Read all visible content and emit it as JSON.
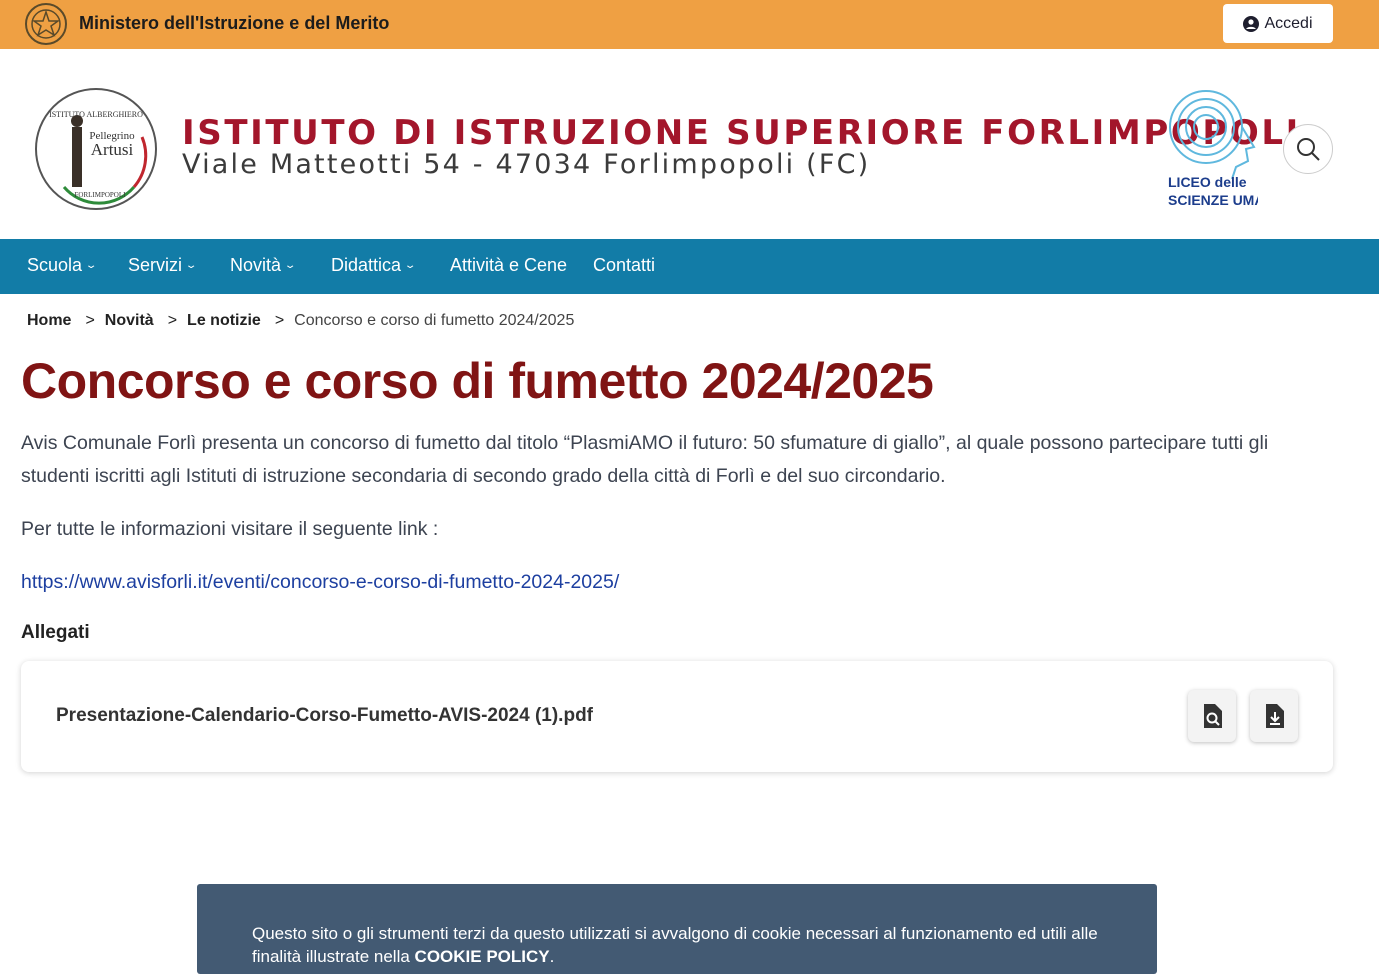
{
  "topbar": {
    "ministry": "Ministero dell'Istruzione e del Merito",
    "login_label": "Accedi",
    "color": "#efa043"
  },
  "header": {
    "school_name": "ISTITUTO DI ISTRUZIONE SUPERIORE FORLIMPOPOLI",
    "address": "Viale Matteotti 54 - 47034 Forlimpopoli (FC)",
    "logo_left_text": {
      "top": "ISTITUTO ALBERGHIERO",
      "name1": "Pellegrino",
      "name2": "Artusi",
      "bottom": "FORLIMPOPOLI"
    },
    "logo_right_text": {
      "line1": "LICEO delle",
      "line2": "SCIENZE UMANE"
    }
  },
  "nav": {
    "color": "#127ca7",
    "items": [
      {
        "label": "Scuola",
        "dropdown": true
      },
      {
        "label": "Servizi",
        "dropdown": true
      },
      {
        "label": "Novità",
        "dropdown": true
      },
      {
        "label": "Didattica",
        "dropdown": true
      },
      {
        "label": "Attività e Cene",
        "dropdown": false
      },
      {
        "label": "Contatti",
        "dropdown": false
      }
    ]
  },
  "breadcrumb": {
    "items": [
      "Home",
      "Novità",
      "Le notizie"
    ],
    "separator": ">",
    "current": "Concorso e corso di fumetto 2024/2025"
  },
  "article": {
    "title": "Concorso e corso di fumetto 2024/2025",
    "paragraph1": "Avis Comunale Forlì presenta un concorso di fumetto dal titolo “PlasmiAMO il futuro: 50 sfumature di giallo”, al quale possono partecipare tutti gli studenti iscritti agli Istituti di istruzione secondaria di secondo grado della città di Forlì e del suo circondario.",
    "paragraph2": "Per tutte le informazioni visitare il seguente link :",
    "link": "https://www.avisforli.it/eventi/concorso-e-corso-di-fumetto-2024-2025/",
    "title_color": "#801414"
  },
  "attachments": {
    "heading": "Allegati",
    "files": [
      {
        "name": "Presentazione-Calendario-Corso-Fumetto-AVIS-2024 (1).pdf"
      }
    ]
  },
  "cookie": {
    "text": "Questo sito o gli strumenti terzi da questo utilizzati si avvalgono di cookie necessari al funzionamento ed utili alle finalità illustrate nella",
    "policy_label": "COOKIE POLICY",
    "end": "."
  }
}
